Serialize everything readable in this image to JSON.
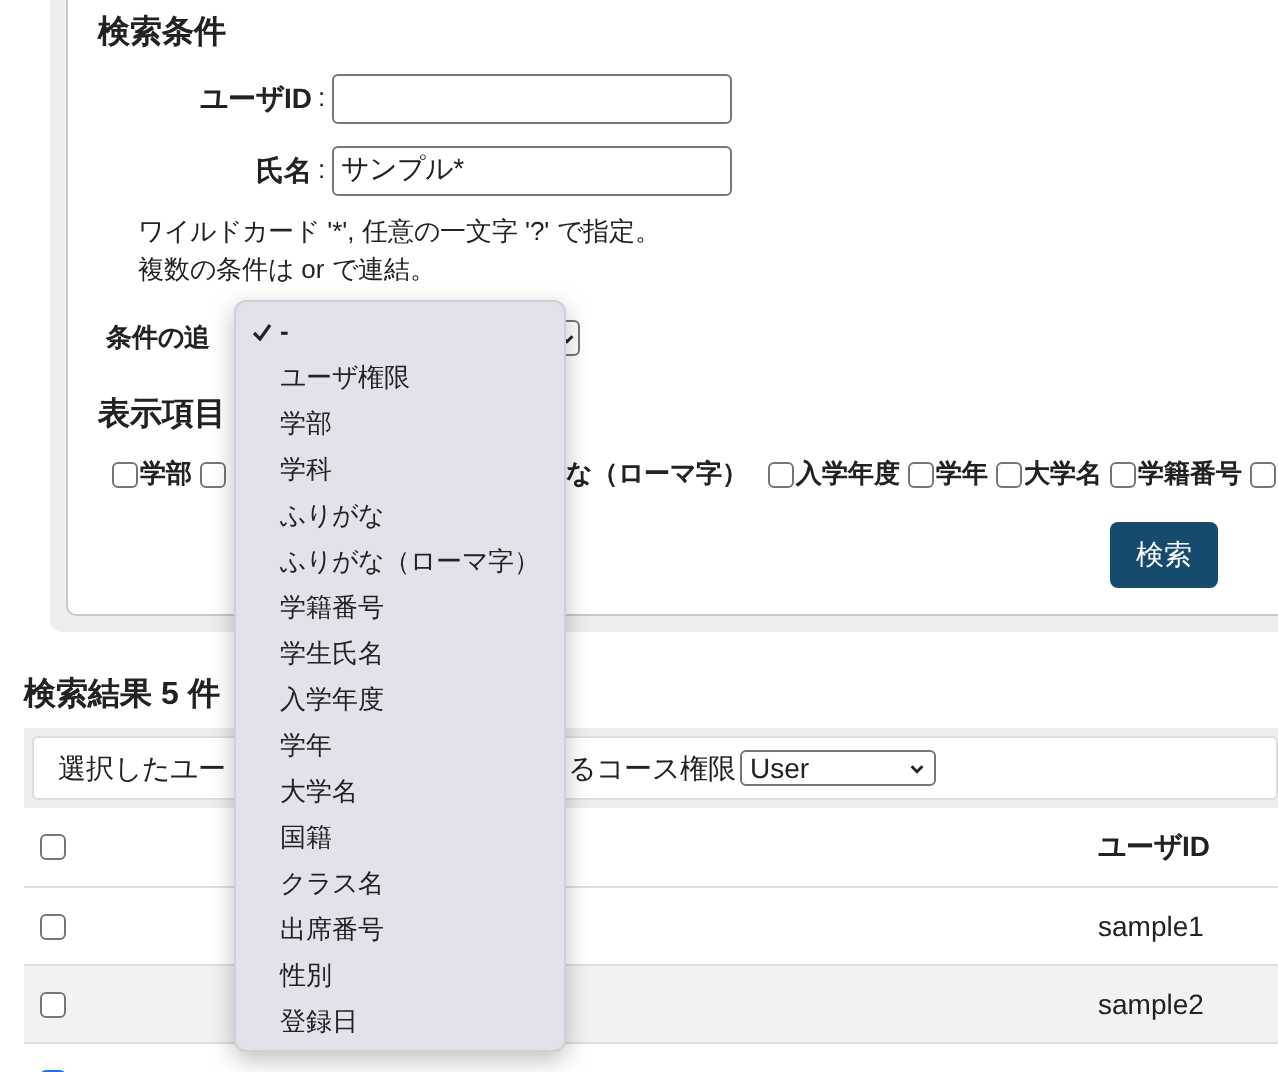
{
  "search_conditions": {
    "title": "検索条件",
    "fields": [
      {
        "label": "ユーザID",
        "separator": ":"
      },
      {
        "label": "氏名",
        "separator": ":",
        "value": "サンプル*"
      }
    ],
    "hints": [
      "ワイルドカード '*', 任意の一文字 '?' で指定。",
      "複数の条件は or で連結。"
    ],
    "add_condition": {
      "label": "条件の追",
      "menu": [
        {
          "label": "-",
          "selected": true
        },
        {
          "label": "ユーザ権限",
          "selected": false
        },
        {
          "label": "学部",
          "selected": false
        },
        {
          "label": "学科",
          "selected": false
        },
        {
          "label": "ふりがな",
          "selected": false
        },
        {
          "label": "ふりがな（ローマ字）",
          "selected": false
        },
        {
          "label": "学籍番号",
          "selected": false
        },
        {
          "label": "学生氏名",
          "selected": false
        },
        {
          "label": "入学年度",
          "selected": false
        },
        {
          "label": "学年",
          "selected": false
        },
        {
          "label": "大学名",
          "selected": false
        },
        {
          "label": "国籍",
          "selected": false
        },
        {
          "label": "クラス名",
          "selected": false
        },
        {
          "label": "出席番号",
          "selected": false
        },
        {
          "label": "性別",
          "selected": false
        },
        {
          "label": "登録日",
          "selected": false
        }
      ]
    },
    "display_title": "表示項目",
    "display_items_before": [
      {
        "label": "学部",
        "checked": false
      },
      {
        "checked": false
      }
    ],
    "display_fragment": "な（ローマ字）",
    "display_items_after": [
      {
        "label": "入学年度",
        "checked": false
      },
      {
        "label": "学年",
        "checked": false
      },
      {
        "label": "大学名",
        "checked": false
      },
      {
        "label": "学籍番号",
        "checked": false
      },
      {
        "checked": false
      }
    ],
    "search_button": "検索"
  },
  "results": {
    "title": "検索結果 5 件",
    "toolbar": {
      "text_left": "選択したユー",
      "text_right": "るコース権限",
      "select_value": "User"
    },
    "header": {
      "checked": false,
      "column": "ユーザID"
    },
    "rows": [
      {
        "checked": false,
        "user_id": "sample1"
      },
      {
        "checked": false,
        "user_id": "sample2"
      },
      {
        "checked": true
      }
    ]
  }
}
